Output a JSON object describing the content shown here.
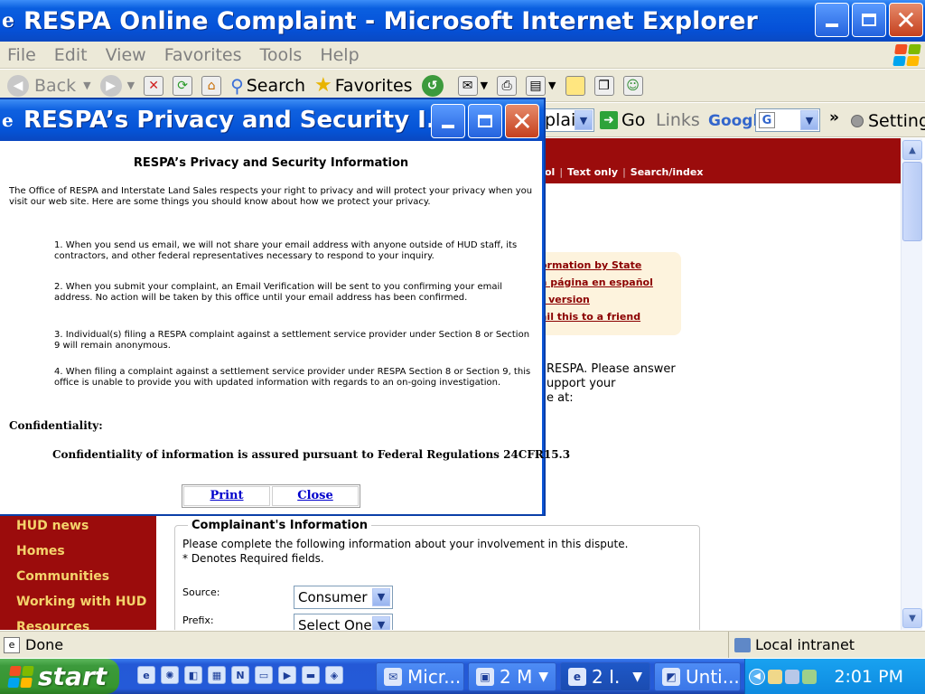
{
  "window": {
    "title": "RESPA Online Complaint - Microsoft Internet Explorer"
  },
  "menu": [
    "File",
    "Edit",
    "View",
    "Favorites",
    "Tools",
    "Help"
  ],
  "toolbar": {
    "back_label": "Back",
    "search_label": "Search",
    "favorites_label": "Favorites"
  },
  "addressbar": {
    "address_fragment": "plai",
    "go_label": "Go",
    "links_label": "Links",
    "google_label": "Google",
    "google_combo": "G",
    "settings_label": "Setting"
  },
  "page": {
    "header_links": [
      "ol",
      "Text only",
      "Search/index"
    ],
    "info_links": [
      "ormation by State",
      "a página en español",
      "t version",
      "ail this to a friend"
    ],
    "intro_lines": [
      "RESPA. Please answer",
      "upport your",
      "e at:"
    ],
    "nav_items": [
      "HUD news",
      "Homes",
      "Communities",
      "Working with HUD",
      "Resources"
    ],
    "form": {
      "legend": "Complainant's Information",
      "instructions": "Please complete the following information about your involvement in this dispute.",
      "required_note": "* Denotes Required fields.",
      "source_label": "Source:",
      "source_value": "Consumer",
      "prefix_label": "Prefix:",
      "prefix_value": "Select One"
    }
  },
  "popup": {
    "title": "RESPA’s Privacy and Security I...",
    "heading": "RESPA’s Privacy and Security Information",
    "intro": "The Office of RESPA and Interstate Land Sales respects your right to privacy and will protect your privacy when you visit our web site. Here are some things you should know about how we protect your privacy.",
    "items": [
      "1. When you send us email, we will not share your email address with anyone outside of HUD staff, its contractors, and other federal representatives necessary to respond to your inquiry.",
      "2. When you submit your complaint, an Email Verification will be sent to you confirming your email address.  No action will be taken by this office until your email address has been confirmed.",
      "3. Individual(s) filing a RESPA complaint against a settlement service provider under Section 8 or Section 9 will remain anonymous.",
      "4. When filing a complaint against a settlement service provider under RESPA Section 8 or Section 9, this office is unable to provide you with updated information with regards to an on-going investigation."
    ],
    "confidentiality_heading": "Confidentiality:",
    "confidentiality_text": "Confidentiality of information is assured pursuant to Federal Regulations 24CFR15.3",
    "print_label": "Print",
    "close_label": "Close"
  },
  "statusbar": {
    "status": "Done",
    "zone": "Local intranet"
  },
  "taskbar": {
    "start_label": "start",
    "tasks": [
      {
        "label": "Micr..."
      },
      {
        "label": "2 M"
      },
      {
        "label": "2 I."
      },
      {
        "label": "Unti..."
      }
    ],
    "clock": "2:01 PM"
  }
}
